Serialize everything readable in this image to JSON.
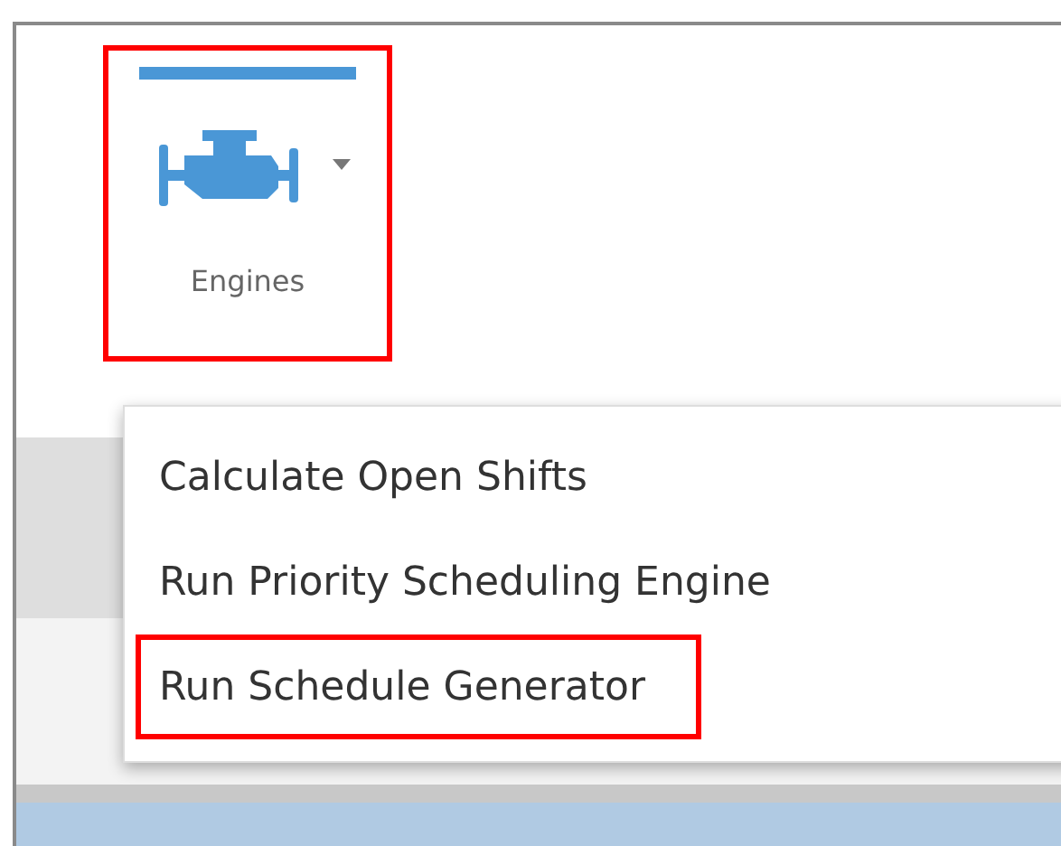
{
  "toolbar": {
    "tab": {
      "label": "Engines",
      "selected": true,
      "highlighted": true
    }
  },
  "menu": {
    "items": [
      {
        "label": "Calculate Open Shifts",
        "highlighted": false
      },
      {
        "label": "Run Priority Scheduling Engine",
        "highlighted": false
      },
      {
        "label": "Run Schedule Generator",
        "highlighted": true
      }
    ]
  }
}
